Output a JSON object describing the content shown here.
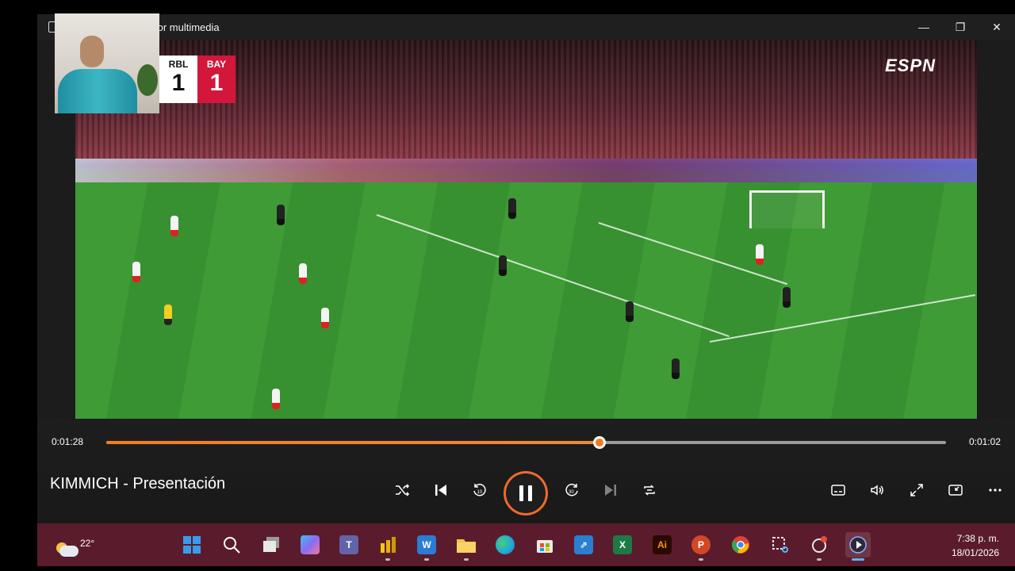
{
  "window": {
    "title": "tor multimedia",
    "controls": {
      "minimize": "—",
      "maximize": "❐",
      "close": "✕"
    }
  },
  "video": {
    "broadcaster": "ESPN",
    "scoreboard": {
      "home": {
        "abbr": "RBL",
        "score": "1"
      },
      "away": {
        "abbr": "BAY",
        "score": "1"
      }
    }
  },
  "player": {
    "time_elapsed": "0:01:28",
    "time_remaining": "0:01:02",
    "progress": 0.587,
    "media_title": "KIMMICH - Presentación",
    "buttons": [
      "shuffle",
      "previous",
      "rewind-10",
      "pause",
      "forward-30",
      "next",
      "repeat",
      "subtitles",
      "volume",
      "fullscreen",
      "mini-player",
      "more"
    ],
    "accent_color": "#f47b20"
  },
  "taskbar": {
    "weather": {
      "temperature": "22°",
      "icon": "partly-cloudy-icon"
    },
    "apps": [
      {
        "name": "start-icon",
        "color": "#3a9bea"
      },
      {
        "name": "search-icon",
        "color": "#ffffff"
      },
      {
        "name": "task-view-icon",
        "color": "#cfcfcf"
      },
      {
        "name": "copilot-icon",
        "color": "#8a6cf0"
      },
      {
        "name": "teams-icon",
        "color": "#6264a7"
      },
      {
        "name": "power-bi-icon",
        "color": "#f2c811"
      },
      {
        "name": "word-icon",
        "color": "#2b7cd3"
      },
      {
        "name": "file-explorer-icon",
        "color": "#f5c542"
      },
      {
        "name": "edge-icon",
        "color": "#1fa6d8"
      },
      {
        "name": "store-icon",
        "color": "#3b8edb"
      },
      {
        "name": "remote-desktop-icon",
        "color": "#2a7fd0"
      },
      {
        "name": "excel-icon",
        "color": "#1d7a45"
      },
      {
        "name": "illustrator-icon",
        "color": "#ff9a00"
      },
      {
        "name": "powerpoint-icon",
        "color": "#d24726"
      },
      {
        "name": "chrome-icon",
        "color": "#34a853"
      },
      {
        "name": "snipping-tool-icon",
        "color": "#e8e8e8"
      },
      {
        "name": "screen-recorder-icon",
        "color": "#e74c3c"
      },
      {
        "name": "media-player-icon",
        "color": "#ffffff"
      }
    ],
    "illustrator_label": "Ai",
    "clock_time": "7:38 p. m.",
    "clock_date": "18/01/2026"
  }
}
